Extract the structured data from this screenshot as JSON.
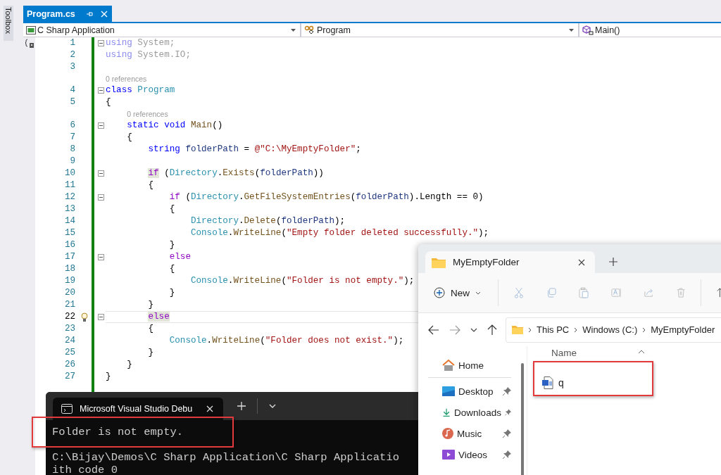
{
  "toolbox": {
    "label": "Toolbox"
  },
  "editor": {
    "tab": {
      "title": "Program.cs",
      "selected": true
    },
    "nav": [
      {
        "kind": "project",
        "text": "C Sharp Application"
      },
      {
        "kind": "class",
        "text": "Program"
      },
      {
        "kind": "method",
        "text": "Main()"
      }
    ],
    "lines": [
      {
        "kind": "code",
        "n": "1",
        "fold": true,
        "current": false,
        "tokens": [
          {
            "t": "using",
            "kind": "kw-dim"
          },
          {
            "t": " System;",
            "kind": "dim"
          }
        ]
      },
      {
        "kind": "code",
        "n": "2",
        "fold": false,
        "current": false,
        "tokens": [
          {
            "t": "using",
            "kind": "kw-dim"
          },
          {
            "t": " System.IO;",
            "kind": "dim"
          }
        ]
      },
      {
        "kind": "code",
        "n": "3",
        "fold": false,
        "current": false
      },
      {
        "kind": "codelens",
        "text": "0 references"
      },
      {
        "kind": "code",
        "n": "4",
        "fold": true,
        "current": false,
        "tokens": [
          {
            "t": "class",
            "kind": "kw"
          },
          {
            "t": " Program",
            "kind": "type"
          }
        ]
      },
      {
        "kind": "code",
        "n": "5",
        "fold": false,
        "current": false,
        "tokens": [
          {
            "t": "{",
            "kind": "plain"
          }
        ]
      },
      {
        "kind": "codelens",
        "text": "0 references"
      },
      {
        "kind": "code",
        "n": "6",
        "fold": true,
        "current": false,
        "tokens": [
          {
            "t": "    static void",
            "kind": "kw"
          },
          {
            "t": " Main",
            "kind": "method"
          },
          {
            "t": "()",
            "kind": "plain"
          }
        ]
      },
      {
        "kind": "code",
        "n": "7",
        "fold": false,
        "current": false,
        "tokens": [
          {
            "t": "    {",
            "kind": "plain"
          }
        ]
      },
      {
        "kind": "code",
        "n": "8",
        "fold": false,
        "current": false,
        "tokens": [
          {
            "t": "        string",
            "kind": "kw"
          },
          {
            "t": " folderPath",
            "kind": "var"
          },
          {
            "t": " = ",
            "kind": "plain"
          },
          {
            "t": "@\"C:\\MyEmptyFolder\"",
            "kind": "str"
          },
          {
            "t": ";",
            "kind": "plain"
          }
        ]
      },
      {
        "kind": "code",
        "n": "9",
        "fold": false,
        "current": false
      },
      {
        "kind": "code",
        "n": "10",
        "fold": true,
        "current": false,
        "tokens": [
          {
            "t": "        if",
            "kind": "ctl-match"
          },
          {
            "t": " (",
            "kind": "plain"
          },
          {
            "t": "Directory",
            "kind": "type"
          },
          {
            "t": ".",
            "kind": "plain"
          },
          {
            "t": "Exists",
            "kind": "method"
          },
          {
            "t": "(",
            "kind": "plain"
          },
          {
            "t": "folderPath",
            "kind": "var"
          },
          {
            "t": "))",
            "kind": "plain"
          }
        ]
      },
      {
        "kind": "code",
        "n": "11",
        "fold": false,
        "current": false,
        "tokens": [
          {
            "t": "        {",
            "kind": "plain"
          }
        ]
      },
      {
        "kind": "code",
        "n": "12",
        "fold": true,
        "current": false,
        "tokens": [
          {
            "t": "            if",
            "kind": "ctl"
          },
          {
            "t": " (",
            "kind": "plain"
          },
          {
            "t": "Directory",
            "kind": "type"
          },
          {
            "t": ".",
            "kind": "plain"
          },
          {
            "t": "GetFileSystemEntries",
            "kind": "method"
          },
          {
            "t": "(",
            "kind": "plain"
          },
          {
            "t": "folderPath",
            "kind": "var"
          },
          {
            "t": ").Length == 0)",
            "kind": "plain"
          }
        ]
      },
      {
        "kind": "code",
        "n": "13",
        "fold": false,
        "current": false,
        "tokens": [
          {
            "t": "            {",
            "kind": "plain"
          }
        ]
      },
      {
        "kind": "code",
        "n": "14",
        "fold": false,
        "current": false,
        "tokens": [
          {
            "t": "                Directory",
            "kind": "type"
          },
          {
            "t": ".",
            "kind": "plain"
          },
          {
            "t": "Delete",
            "kind": "method"
          },
          {
            "t": "(",
            "kind": "plain"
          },
          {
            "t": "folderPath",
            "kind": "var"
          },
          {
            "t": ");",
            "kind": "plain"
          }
        ]
      },
      {
        "kind": "code",
        "n": "15",
        "fold": false,
        "current": false,
        "tokens": [
          {
            "t": "                Console",
            "kind": "type"
          },
          {
            "t": ".",
            "kind": "plain"
          },
          {
            "t": "WriteLine",
            "kind": "method"
          },
          {
            "t": "(",
            "kind": "plain"
          },
          {
            "t": "\"Empty folder deleted successfully.\"",
            "kind": "str"
          },
          {
            "t": ");",
            "kind": "plain"
          }
        ]
      },
      {
        "kind": "code",
        "n": "16",
        "fold": false,
        "current": false,
        "tokens": [
          {
            "t": "            }",
            "kind": "plain"
          }
        ]
      },
      {
        "kind": "code",
        "n": "17",
        "fold": true,
        "current": false,
        "tokens": [
          {
            "t": "            else",
            "kind": "ctl"
          }
        ]
      },
      {
        "kind": "code",
        "n": "18",
        "fold": false,
        "current": false,
        "tokens": [
          {
            "t": "            {",
            "kind": "plain"
          }
        ]
      },
      {
        "kind": "code",
        "n": "19",
        "fold": false,
        "current": false,
        "tokens": [
          {
            "t": "                Console",
            "kind": "type"
          },
          {
            "t": ".",
            "kind": "plain"
          },
          {
            "t": "WriteLine",
            "kind": "method"
          },
          {
            "t": "(",
            "kind": "plain"
          },
          {
            "t": "\"Folder is not empty.\"",
            "kind": "str"
          },
          {
            "t": ");",
            "kind": "plain"
          }
        ]
      },
      {
        "kind": "code",
        "n": "20",
        "fold": false,
        "current": false,
        "tokens": [
          {
            "t": "            }",
            "kind": "plain"
          }
        ]
      },
      {
        "kind": "code",
        "n": "21",
        "fold": false,
        "current": false,
        "tokens": [
          {
            "t": "        }",
            "kind": "plain"
          }
        ]
      },
      {
        "kind": "code",
        "n": "22",
        "fold": true,
        "current": true,
        "tokens": [
          {
            "t": "        else",
            "kind": "ctl-match"
          }
        ]
      },
      {
        "kind": "code",
        "n": "23",
        "fold": false,
        "current": false,
        "tokens": [
          {
            "t": "        {",
            "kind": "plain"
          }
        ]
      },
      {
        "kind": "code",
        "n": "24",
        "fold": false,
        "current": false,
        "tokens": [
          {
            "t": "            Console",
            "kind": "type"
          },
          {
            "t": ".",
            "kind": "plain"
          },
          {
            "t": "WriteLine",
            "kind": "method"
          },
          {
            "t": "(",
            "kind": "plain"
          },
          {
            "t": "\"Folder does not exist.\"",
            "kind": "str"
          },
          {
            "t": ");",
            "kind": "plain"
          }
        ]
      },
      {
        "kind": "code",
        "n": "25",
        "fold": false,
        "current": false,
        "tokens": [
          {
            "t": "        }",
            "kind": "plain"
          }
        ]
      },
      {
        "kind": "code",
        "n": "26",
        "fold": false,
        "current": false,
        "tokens": [
          {
            "t": "    }",
            "kind": "plain"
          }
        ]
      },
      {
        "kind": "code",
        "n": "27",
        "fold": false,
        "current": false,
        "tokens": [
          {
            "t": "}",
            "kind": "plain"
          }
        ]
      }
    ]
  },
  "terminal": {
    "tab_title": "Microsoft Visual Studio Debu",
    "output": [
      "Folder is not empty.",
      "C:\\Bijay\\Demos\\C Sharp Application\\C Sharp Applicatio",
      "ith code 0"
    ]
  },
  "explorer": {
    "tab_title": "MyEmptyFolder",
    "new_label": "New",
    "breadcrumb": [
      "This PC",
      "Windows (C:)",
      "MyEmptyFolder"
    ],
    "nav": [
      {
        "kind": "home",
        "label": "Home",
        "pinned": false
      },
      {
        "kind": "desktop",
        "label": "Desktop",
        "pinned": true
      },
      {
        "kind": "downloads",
        "label": "Downloads",
        "pinned": true
      },
      {
        "kind": "music",
        "label": "Music",
        "pinned": true
      },
      {
        "kind": "videos",
        "label": "Videos",
        "pinned": true
      }
    ],
    "column": "Name",
    "files": [
      {
        "kind": "word",
        "name": "q"
      }
    ]
  }
}
